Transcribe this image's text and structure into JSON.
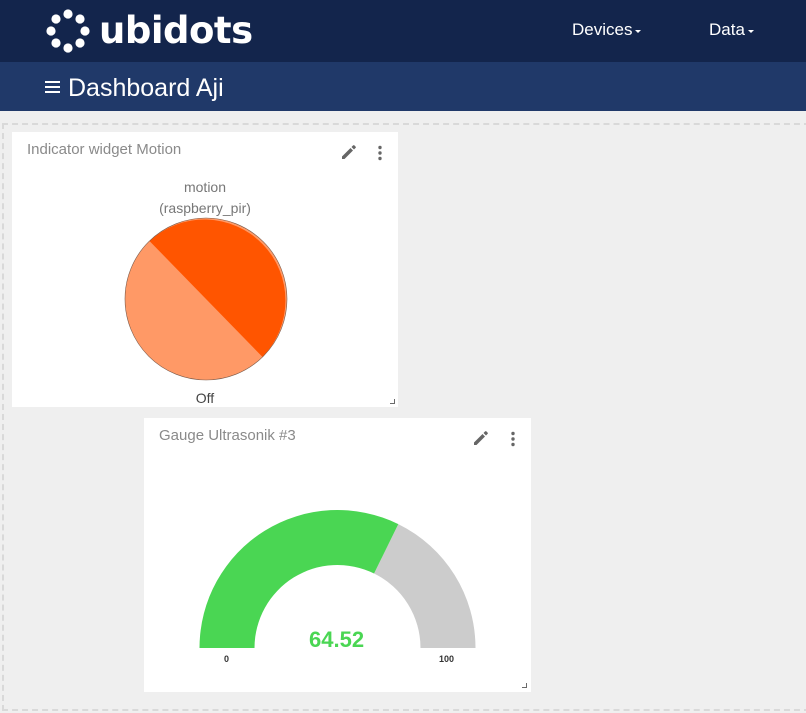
{
  "header": {
    "logo_text": "ubidots",
    "nav": [
      {
        "label": "Devices"
      },
      {
        "label": "Data"
      }
    ]
  },
  "subheader": {
    "title": "Dashboard Aji"
  },
  "widgets": {
    "indicator": {
      "title": "Indicator widget Motion",
      "variable": "motion",
      "device": "(raspberry_pir)",
      "state": "Off",
      "colors": {
        "dark": "#ff5500",
        "light": "#ff9966"
      }
    },
    "gauge": {
      "title": "Gauge Ultrasonik #3",
      "value": "64.52",
      "min": "0",
      "max": "100",
      "colors": {
        "fill": "#4ad653",
        "track": "#cccccc"
      }
    }
  },
  "chart_data": {
    "type": "gauge",
    "value": 64.52,
    "min": 0,
    "max": 100
  },
  "icons": {
    "menu": "hamburger-icon",
    "edit": "pencil-icon",
    "more": "kebab-icon",
    "resize": "resize-handle-icon"
  }
}
